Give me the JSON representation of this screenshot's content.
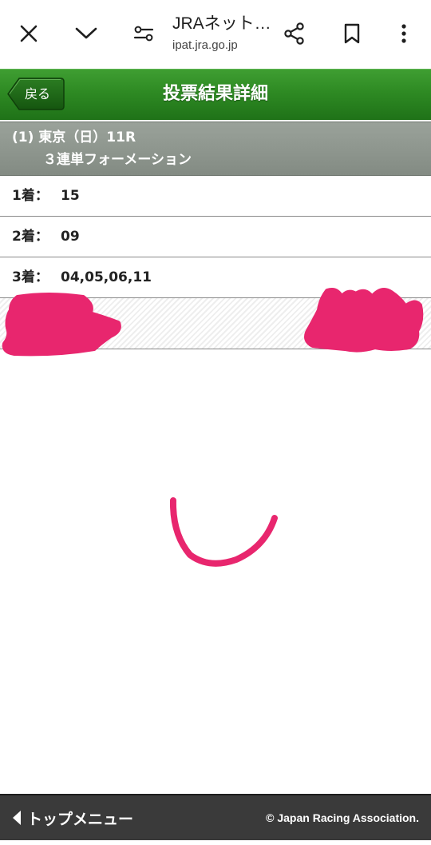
{
  "browser": {
    "title": "JRAネット…",
    "url": "ipat.jra.go.jp",
    "icons": [
      "close-icon",
      "chevron-down-icon",
      "page-settings-icon",
      "share-icon",
      "bookmark-icon",
      "more-vert-icon"
    ]
  },
  "header": {
    "back_label": "戻る",
    "title": "投票結果詳細",
    "color": "#2e8a23"
  },
  "race": {
    "line1": "(1) 東京（日）11R",
    "line2": "３連単フォーメーション"
  },
  "results": [
    {
      "label": "1着：",
      "value": "15"
    },
    {
      "label": "2着：",
      "value": "09"
    },
    {
      "label": "3着：",
      "value": "04,05,06,11"
    }
  ],
  "footer": {
    "top_menu_label": "トップメニュー",
    "copyright": "© Japan Racing Association."
  },
  "colors": {
    "scribble": "#e8266e",
    "footer_bg": "#3a3a3a"
  }
}
